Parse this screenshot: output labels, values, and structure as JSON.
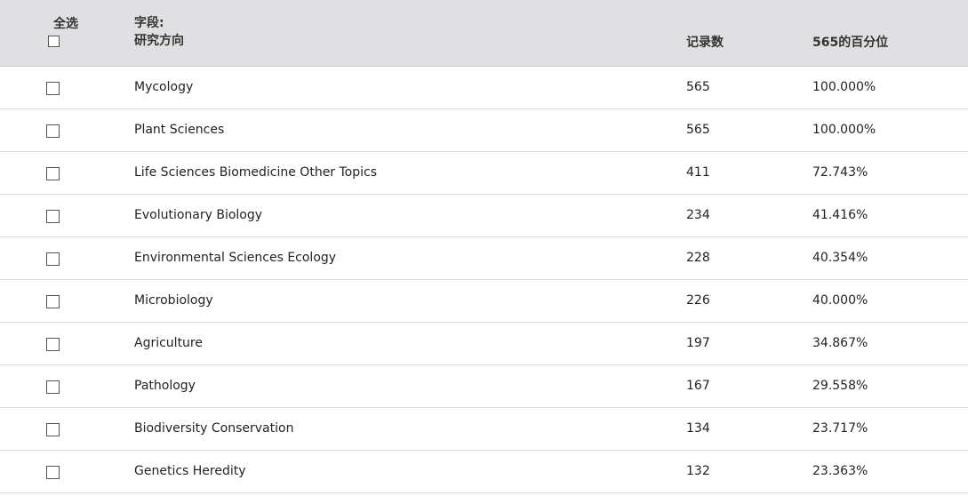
{
  "header": {
    "select_all_label": "全选",
    "field_label": "字段:",
    "field_name": "研究方向",
    "count_label": "记录数",
    "percent_label": "565的百分位"
  },
  "rows": [
    {
      "name": "Mycology",
      "count": "565",
      "percent": "100.000%"
    },
    {
      "name": "Plant Sciences",
      "count": "565",
      "percent": "100.000%"
    },
    {
      "name": "Life Sciences Biomedicine Other Topics",
      "count": "411",
      "percent": "72.743%"
    },
    {
      "name": "Evolutionary Biology",
      "count": "234",
      "percent": "41.416%"
    },
    {
      "name": "Environmental Sciences Ecology",
      "count": "228",
      "percent": "40.354%"
    },
    {
      "name": "Microbiology",
      "count": "226",
      "percent": "40.000%"
    },
    {
      "name": "Agriculture",
      "count": "197",
      "percent": "34.867%"
    },
    {
      "name": "Pathology",
      "count": "167",
      "percent": "29.558%"
    },
    {
      "name": "Biodiversity Conservation",
      "count": "134",
      "percent": "23.717%"
    },
    {
      "name": "Genetics Heredity",
      "count": "132",
      "percent": "23.363%"
    }
  ]
}
